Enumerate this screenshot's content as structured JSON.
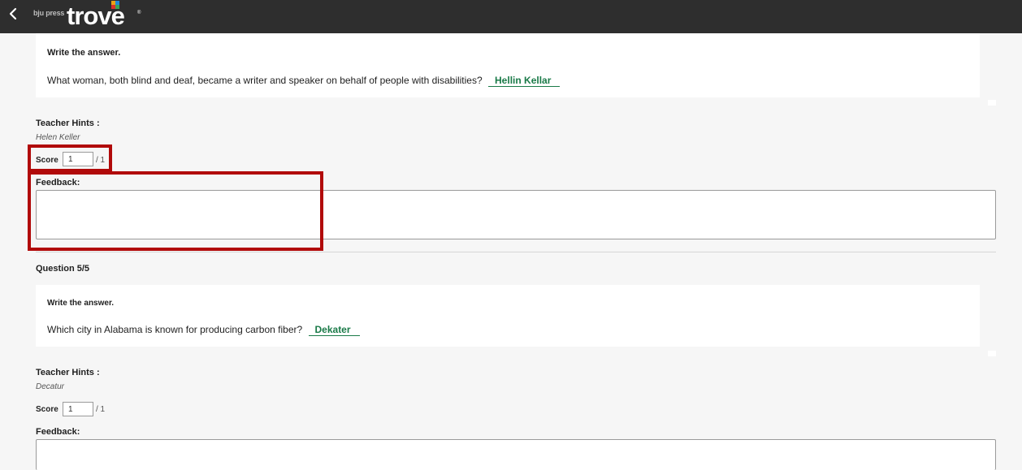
{
  "header": {
    "brand_small": "bju press",
    "brand_main": "trove",
    "brand_mark": "®",
    "back_icon": "chevron-left-icon"
  },
  "questions": [
    {
      "instruction": "Write the answer.",
      "text": "What woman, both blind and deaf, became a writer and speaker on behalf of people with disabilities?",
      "student_answer": "Hellin Kellar",
      "hints_label": "Teacher Hints :",
      "hint": "Helen Keller",
      "score_label": "Score",
      "score_value": "1",
      "score_max": "/ 1",
      "feedback_label": "Feedback:",
      "feedback_value": ""
    },
    {
      "number_label": "Question 5/5",
      "instruction": "Write the answer.",
      "text": "Which city in Alabama is known for producing carbon fiber?",
      "student_answer": "Dekater",
      "hints_label": "Teacher Hints :",
      "hint": "Decatur",
      "score_label": "Score",
      "score_value": "1",
      "score_max": "/ 1",
      "feedback_label": "Feedback:",
      "feedback_value": ""
    }
  ],
  "colors": {
    "topbar": "#2e2e2e",
    "answer": "#1a7a48",
    "highlight": "#b10a0a",
    "background": "#f6f6f6"
  }
}
